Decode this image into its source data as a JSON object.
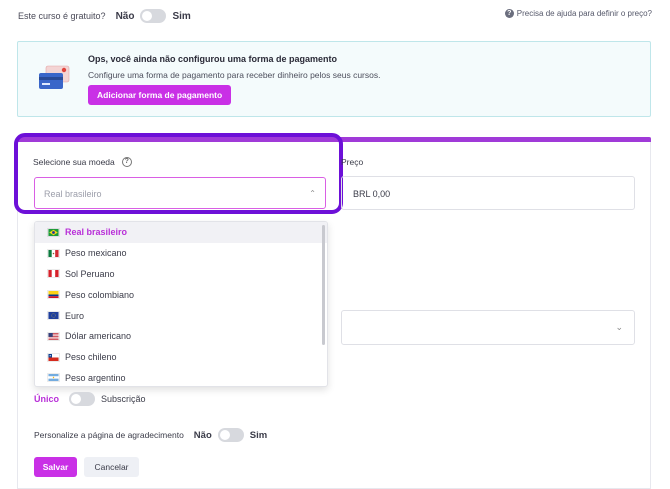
{
  "free_course": {
    "question": "Este curso é gratuito?",
    "no_label": "Não",
    "yes_label": "Sim"
  },
  "help": {
    "icon": "question-circle-icon",
    "text": "Precisa de ajuda para definir o preço?"
  },
  "payment_alert": {
    "title": "Ops, você ainda não configurou uma forma de pagamento",
    "description": "Configure uma forma de pagamento para receber dinheiro pelos seus cursos.",
    "button_label": "Adicionar forma de pagamento"
  },
  "currency": {
    "label": "Selecione sua moeda",
    "placeholder": "Real brasileiro",
    "options": [
      {
        "label": "Real brasileiro",
        "flag": "brazil-flag-icon",
        "selected": true
      },
      {
        "label": "Peso mexicano",
        "flag": "mexico-flag-icon"
      },
      {
        "label": "Sol Peruano",
        "flag": "peru-flag-icon"
      },
      {
        "label": "Peso colombiano",
        "flag": "colombia-flag-icon"
      },
      {
        "label": "Euro",
        "flag": "eu-flag-icon"
      },
      {
        "label": "Dólar americano",
        "flag": "usa-flag-icon"
      },
      {
        "label": "Peso chileno",
        "flag": "chile-flag-icon"
      },
      {
        "label": "Peso argentino",
        "flag": "argentina-flag-icon"
      }
    ]
  },
  "price": {
    "label": "Preço",
    "value": "BRL 0,00"
  },
  "payment_type": {
    "single": "Único",
    "subscription": "Subscrição"
  },
  "thanks_page": {
    "question": "Personalize a página de agradecimento",
    "no_label": "Não",
    "yes_label": "Sim"
  },
  "actions": {
    "save": "Salvar",
    "cancel": "Cancelar"
  },
  "colors": {
    "accent": "#c930e6",
    "highlight": "#6d10d8",
    "alert_border": "#bfe6ea"
  }
}
